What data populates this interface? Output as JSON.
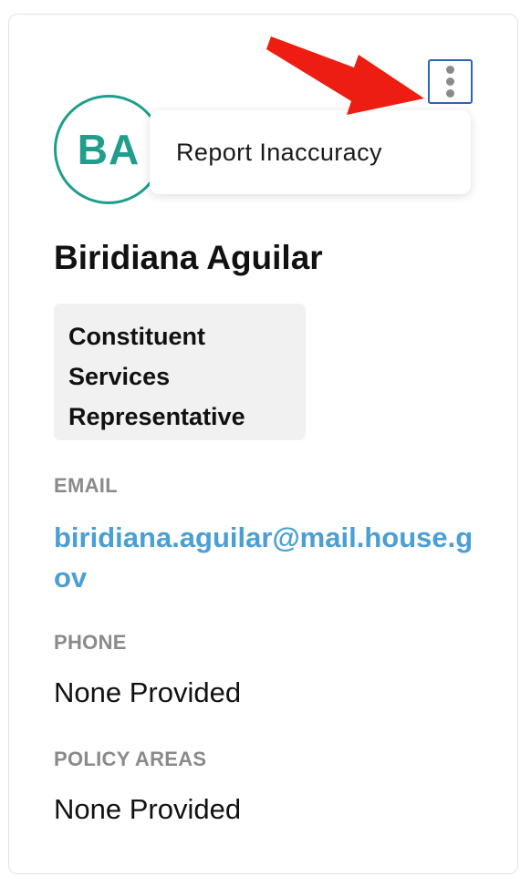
{
  "profile": {
    "initials": "BA",
    "name": "Biridiana Aguilar",
    "title_lines": [
      "Constituent",
      "Services",
      "Representative"
    ]
  },
  "menu": {
    "items": [
      "Report Inaccuracy"
    ]
  },
  "fields": {
    "email_label": "EMAIL",
    "email_value": "biridiana.aguilar@mail.house.gov",
    "phone_label": "PHONE",
    "phone_value": "None Provided",
    "policy_label": "POLICY AREAS",
    "policy_value": "None Provided"
  },
  "icons": {
    "menu_button": "vertical-ellipsis-icon",
    "annotation": "red-arrow-icon"
  },
  "colors": {
    "avatar_accent": "#1f9e8d",
    "link": "#4a9fd4",
    "focus_outline": "#2c63b6",
    "label_gray": "#8a8a8a",
    "badge_bg": "#f1f1f1",
    "arrow_red": "#ee1d12"
  }
}
